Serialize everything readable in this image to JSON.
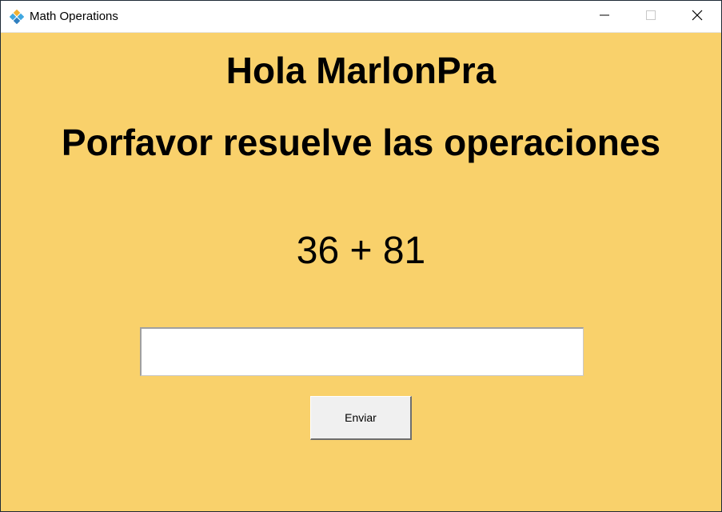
{
  "window": {
    "title": "Math Operations",
    "app_icon": "feather-icon",
    "controls": {
      "minimize_icon": "minimize-icon",
      "maximize_icon": "maximize-icon",
      "close_icon": "close-icon"
    }
  },
  "main": {
    "greeting": "Hola MarlonPra",
    "instruction": "Porfavor resuelve las operaciones",
    "operation": "36 + 81",
    "answer_input": {
      "value": "",
      "placeholder": ""
    },
    "submit_label": "Enviar"
  },
  "colors": {
    "background": "#f9d16b",
    "titlebar": "#ffffff",
    "text": "#000000",
    "button": "#f0f0f0"
  }
}
